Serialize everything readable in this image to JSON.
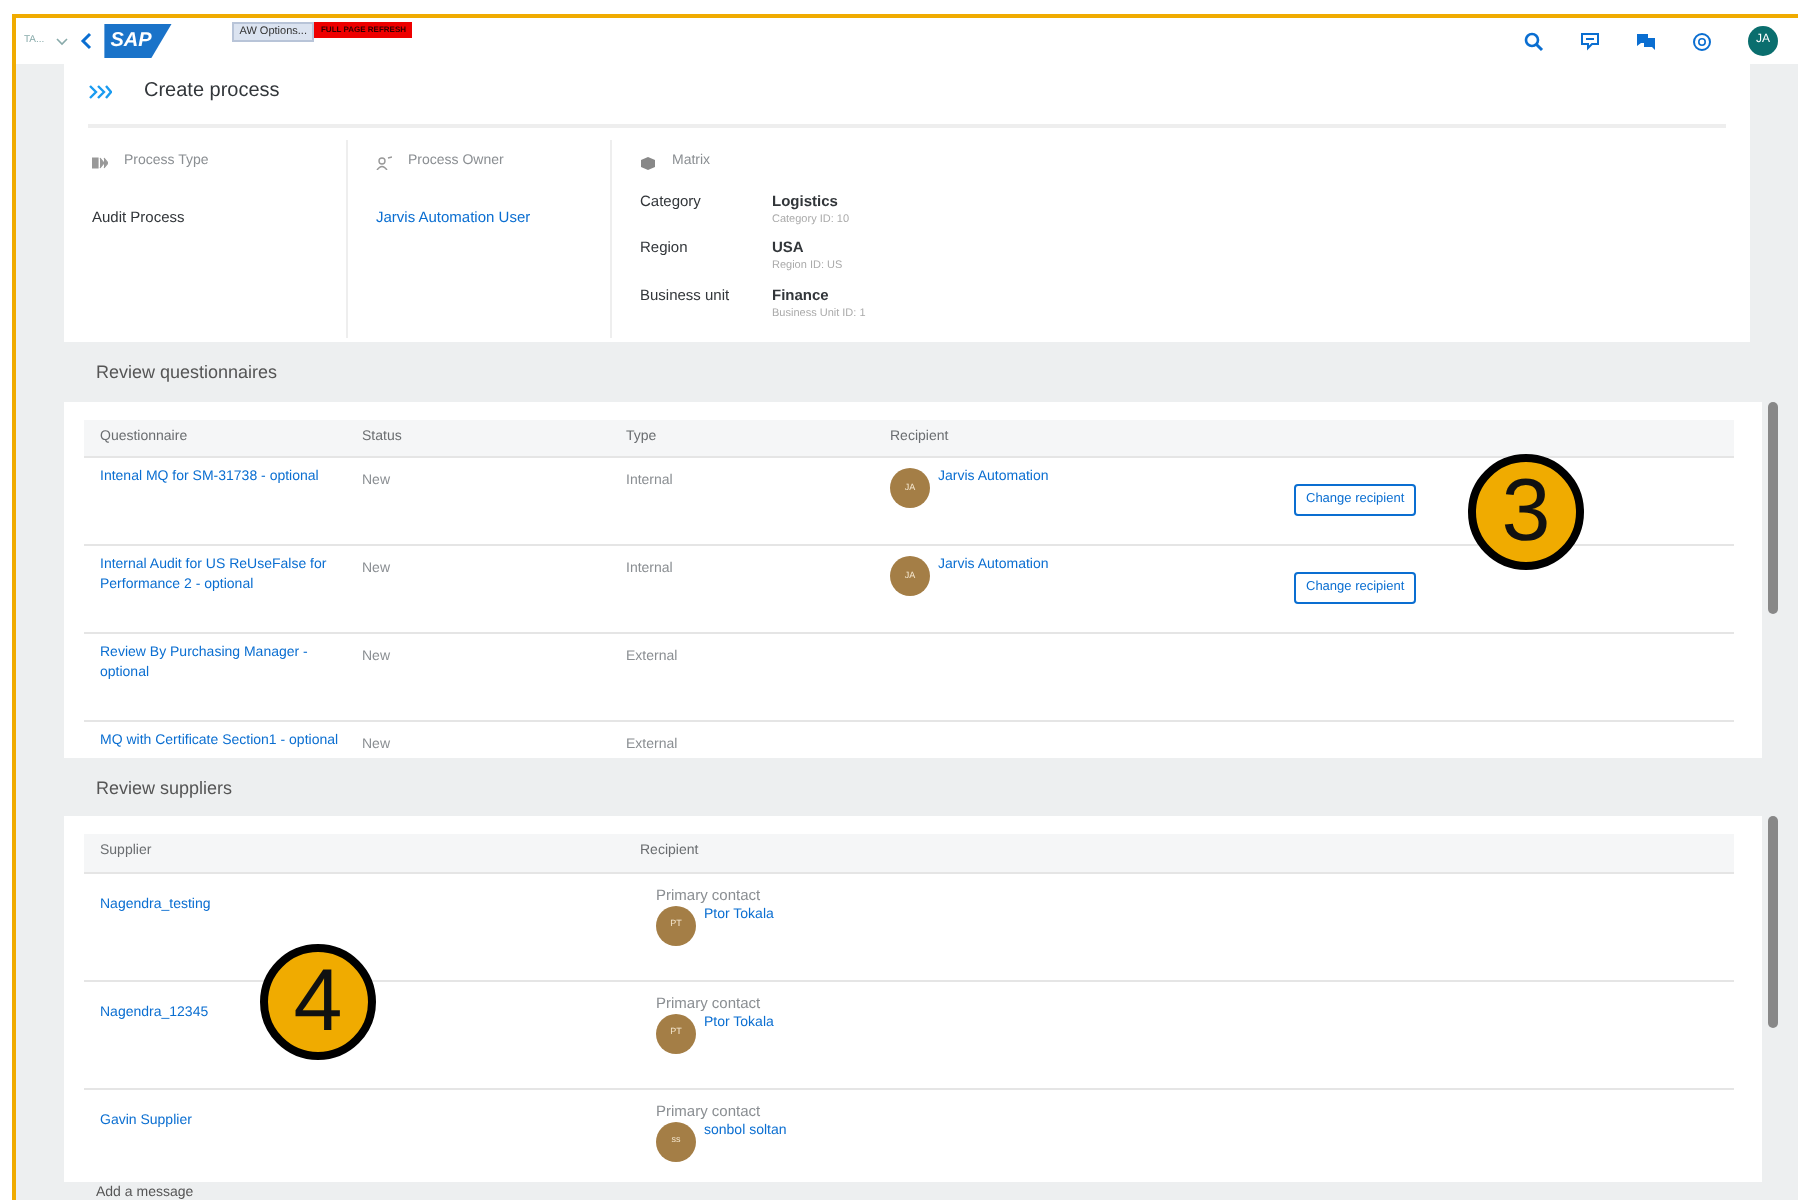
{
  "shell": {
    "menu_label": "TA...",
    "options_button": "AW Options...",
    "refresh_button": "FULL PAGE REFRESH",
    "logo": "SAP",
    "avatar": "JA"
  },
  "page": {
    "title": "Create process"
  },
  "header": {
    "process_type": {
      "label": "Process Type",
      "value": "Audit Process"
    },
    "process_owner": {
      "label": "Process Owner",
      "value": "Jarvis Automation User"
    },
    "matrix": {
      "label": "Matrix",
      "rows": [
        {
          "name": "Category",
          "value": "Logistics",
          "detail": "Category ID: 10"
        },
        {
          "name": "Region",
          "value": "USA",
          "detail": "Region ID: US"
        },
        {
          "name": "Business unit",
          "value": "Finance",
          "detail": "Business Unit ID: 1"
        }
      ]
    }
  },
  "questionnaires": {
    "title": "Review questionnaires",
    "columns": [
      "Questionnaire",
      "Status",
      "Type",
      "Recipient"
    ],
    "rows": [
      {
        "name": "Intenal MQ for SM-31738 - optional",
        "status": "New",
        "type": "Internal",
        "recipient": {
          "initials": "JA",
          "name": "Jarvis Automation"
        },
        "action": "Change recipient"
      },
      {
        "name": "Internal Audit for US ReUseFalse for Performance 2 - optional",
        "status": "New",
        "type": "Internal",
        "recipient": {
          "initials": "JA",
          "name": "Jarvis Automation"
        },
        "action": "Change recipient"
      },
      {
        "name": "Review By Purchasing Manager - optional",
        "status": "New",
        "type": "External"
      },
      {
        "name": "MQ with Certificate Section1 - optional",
        "status": "New",
        "type": "External"
      }
    ]
  },
  "suppliers": {
    "title": "Review suppliers",
    "columns": [
      "Supplier",
      "Recipient"
    ],
    "rows": [
      {
        "supplier": "Nagendra_testing",
        "contact_label": "Primary contact",
        "initials": "PT",
        "name": "Ptor Tokala"
      },
      {
        "supplier": "Nagendra_12345",
        "contact_label": "Primary contact",
        "initials": "PT",
        "name": "Ptor Tokala"
      },
      {
        "supplier": "Gavin Supplier",
        "contact_label": "Primary contact",
        "initials": "ss",
        "name": "sonbol soltan"
      }
    ]
  },
  "next_section": {
    "title": "Add a message"
  },
  "callouts": [
    "3",
    "4"
  ]
}
